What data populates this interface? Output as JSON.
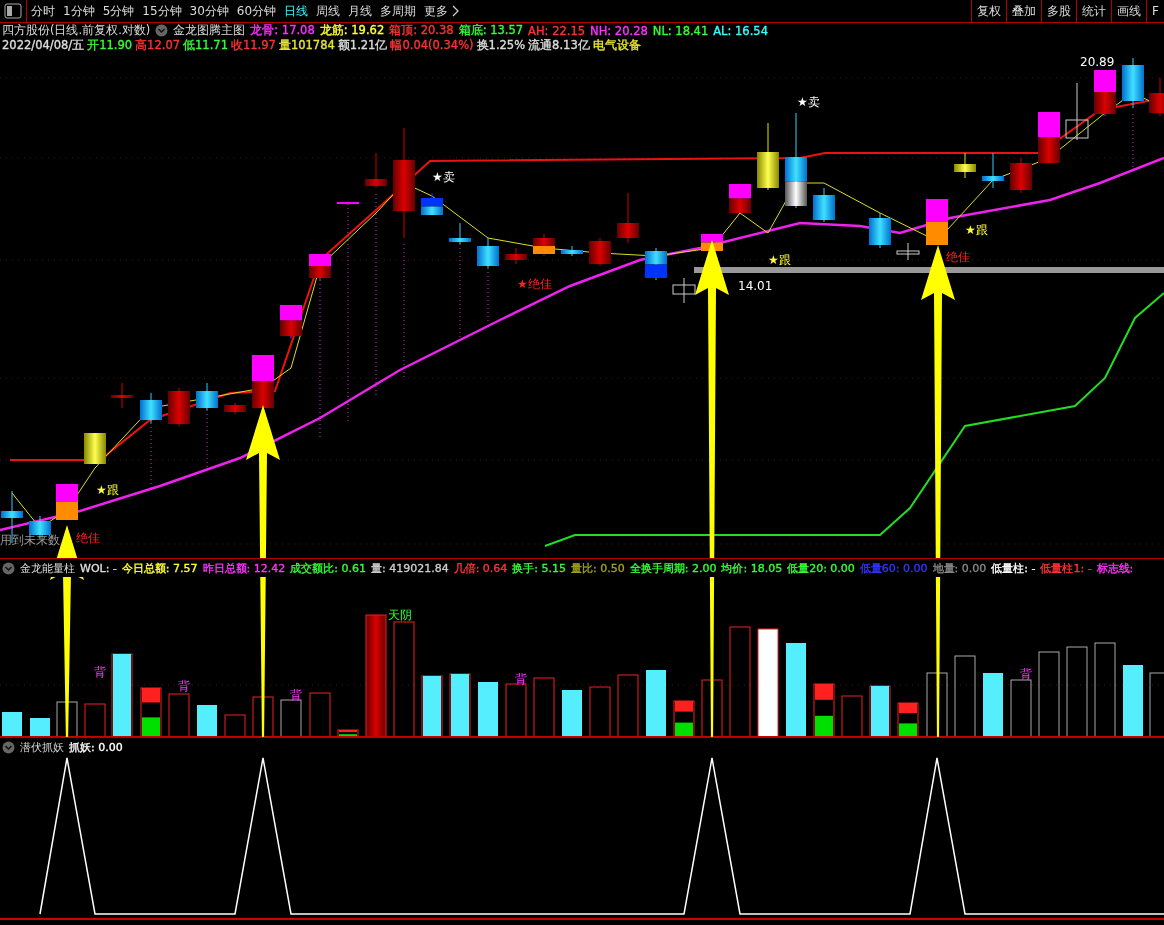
{
  "toolbar": {
    "tabs": [
      {
        "label": "分时",
        "selected": false
      },
      {
        "label": "1分钟",
        "selected": false
      },
      {
        "label": "5分钟",
        "selected": false
      },
      {
        "label": "15分钟",
        "selected": false
      },
      {
        "label": "30分钟",
        "selected": false
      },
      {
        "label": "60分钟",
        "selected": false
      },
      {
        "label": "日线",
        "selected": true
      },
      {
        "label": "周线",
        "selected": false
      },
      {
        "label": "月线",
        "selected": false
      },
      {
        "label": "多周期",
        "selected": false
      }
    ],
    "more": "更多",
    "buttons": [
      "复权",
      "叠加",
      "多股",
      "统计",
      "画线",
      "F"
    ]
  },
  "price_header": {
    "title": "四方股份(日线.前复权.对数)",
    "indicator": "金龙图腾主图",
    "values": [
      {
        "text": "龙骨: 17.08",
        "color": "#ff33ff"
      },
      {
        "text": "龙筋: 19.62",
        "color": "#ffff33"
      },
      {
        "text": "箱顶: 20.38",
        "color": "#ff3333"
      },
      {
        "text": "箱底: 13.57",
        "color": "#33ff33"
      },
      {
        "text": "AH: 22.15",
        "color": "#ff3333"
      },
      {
        "text": "NH: 20.28",
        "color": "#ff33ff"
      },
      {
        "text": "NL: 18.41",
        "color": "#33ff33"
      },
      {
        "text": "AL: 16.54",
        "color": "#33ffff"
      }
    ],
    "quote": [
      {
        "text": "2022/04/08/五",
        "color": "#dddddd"
      },
      {
        "text": "开11.90",
        "color": "#33ff33"
      },
      {
        "text": "高12.07",
        "color": "#ff3333"
      },
      {
        "text": "低11.71",
        "color": "#33ff33"
      },
      {
        "text": "收11.97",
        "color": "#ff3333"
      },
      {
        "text": "量101784",
        "color": "#e6e633"
      },
      {
        "text": "额1.21亿",
        "color": "#dddddd"
      },
      {
        "text": "幅0.04(0.34%)",
        "color": "#ff3333"
      },
      {
        "text": "换1.25%",
        "color": "#dddddd"
      },
      {
        "text": "流通8.13亿",
        "color": "#dddddd"
      },
      {
        "text": "电气设备",
        "color": "#e6e633"
      }
    ]
  },
  "price_chart": {
    "labels": [
      {
        "text": "20.89",
        "kind": "price"
      },
      {
        "text": "★卖",
        "kind": "sell"
      },
      {
        "text": "★卖",
        "kind": "sell"
      },
      {
        "text": "★跟",
        "kind": "follow"
      },
      {
        "text": "★跟",
        "kind": "follow"
      },
      {
        "text": "★跟",
        "kind": "follow"
      },
      {
        "text": "★绝佳",
        "kind": "best"
      },
      {
        "text": "绝佳",
        "kind": "best"
      },
      {
        "text": "绝佳",
        "kind": "best"
      },
      {
        "text": "14.01",
        "kind": "price"
      },
      {
        "text": "用到未来数",
        "kind": "note"
      }
    ]
  },
  "volume_header": {
    "indicator": "金龙能量柱",
    "values": [
      {
        "text": "WOL: -",
        "color": "#dddddd"
      },
      {
        "text": "今日总额: 7.57",
        "color": "#ffff33"
      },
      {
        "text": "昨日总额: 12.42",
        "color": "#ff33ff"
      },
      {
        "text": "成交额比: 0.61",
        "color": "#33ff33"
      },
      {
        "text": "量: 419021.84",
        "color": "#cccccc"
      },
      {
        "text": "几倍: 0.64",
        "color": "#ff3333"
      },
      {
        "text": "换手: 5.15",
        "color": "#33ff33"
      },
      {
        "text": "量比: 0.50",
        "color": "#a0a020"
      },
      {
        "text": "全换手周期: 2.00",
        "color": "#33ff33"
      },
      {
        "text": "均价: 18.05",
        "color": "#33ff33"
      },
      {
        "text": "低量20: 0.00",
        "color": "#33ff33"
      },
      {
        "text": "低量60: 0.00",
        "color": "#3333ff"
      },
      {
        "text": "地量: 0.00",
        "color": "#888888"
      },
      {
        "text": "低量柱: -",
        "color": "#ffffff"
      },
      {
        "text": "低量柱1: -",
        "color": "#ff3333"
      },
      {
        "text": "标志线:",
        "color": "#ff33ff"
      }
    ]
  },
  "volume_chart": {
    "labels": [
      {
        "text": "天阴",
        "kind": "tian"
      },
      {
        "text": "背",
        "kind": "bei"
      },
      {
        "text": "背",
        "kind": "bei"
      },
      {
        "text": "背",
        "kind": "bei"
      },
      {
        "text": "背",
        "kind": "bei"
      },
      {
        "text": "背",
        "kind": "bei"
      }
    ]
  },
  "signal_header": {
    "indicator": "潜伏抓妖",
    "value": "抓妖: 0.00"
  }
}
